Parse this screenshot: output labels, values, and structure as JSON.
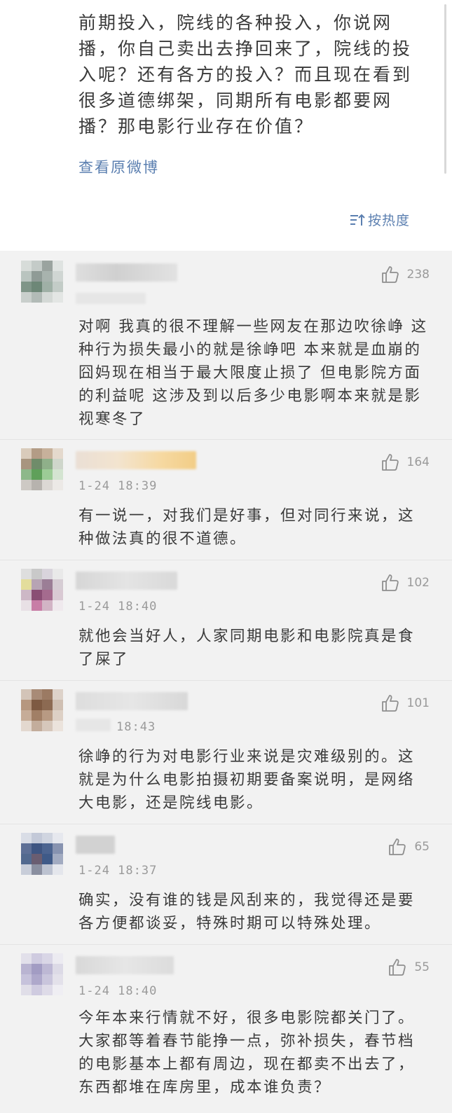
{
  "post": {
    "text": "前期投入，院线的各种投入，你说网播，你自己卖出去挣回来了，院线的投入呢？还有各方的投入？而且现在看到很多道德绑架，同期所有电影都要网播？那电影行业存在价值？",
    "view_original": "查看原微博",
    "sort_label": "按热度"
  },
  "comments": [
    {
      "likes": "238",
      "time": "",
      "text": "对啊 我真的很不理解一些网友在那边吹徐峥 这种行为损失最小的就是徐峥吧 本来就是血崩的囧妈现在相当于最大限度止损了 但电影院方面的利益呢 这涉及到以后多少电影啊本来就是影视寒冬了"
    },
    {
      "likes": "164",
      "time": "1-24 18:39",
      "text": "有一说一，对我们是好事，但对同行来说，这种做法真的很不道德。"
    },
    {
      "likes": "102",
      "time": "1-24 18:40",
      "text": "就他会当好人，人家同期电影和电影院真是食了屎了"
    },
    {
      "likes": "101",
      "time": "18:43",
      "text": "徐峥的行为对电影行业来说是灾难级别的。这就是为什么电影拍摄初期要备案说明，是网络大电影，还是院线电影。"
    },
    {
      "likes": "65",
      "time": "1-24 18:37",
      "text": "确实，没有谁的钱是风刮来的，我觉得还是要各方便都谈妥，特殊时期可以特殊处理。"
    },
    {
      "likes": "55",
      "time": "1-24 18:40",
      "text": "今年本来行情就不好，很多电影院都关门了。大家都等着春节能挣一点，弥补损失，春节档的电影基本上都有周边，现在都卖不出去了，东西都堆在库房里，成本谁负责？"
    }
  ],
  "icons": {
    "like": "thumbs-up-icon",
    "sort": "sort-icon"
  },
  "colors": {
    "link": "#5b7fb0",
    "meta": "#9a9a9a",
    "page_bg": "#f2f2f2"
  }
}
